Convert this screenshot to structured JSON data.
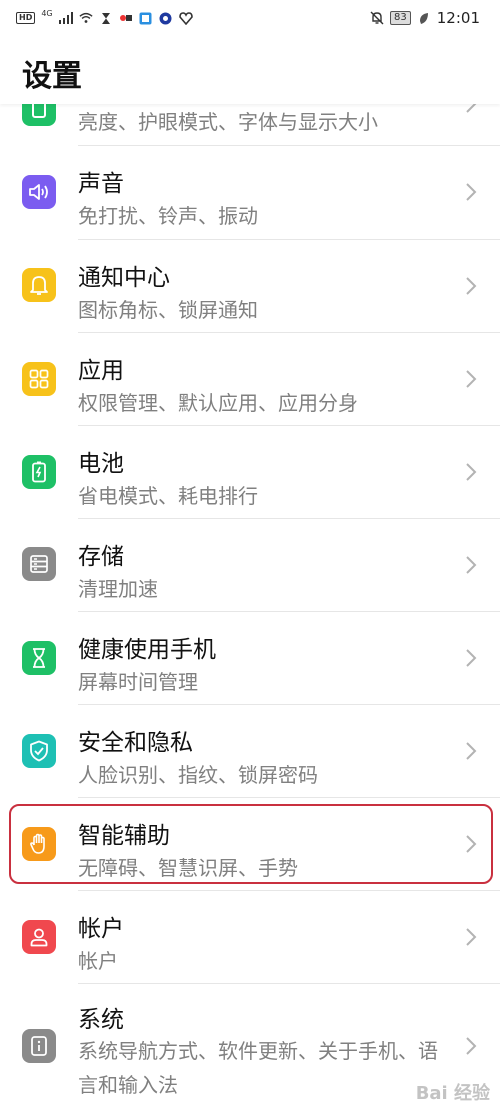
{
  "status_bar": {
    "hd": "HD",
    "network": "4G",
    "battery": "83",
    "time": "12:01"
  },
  "header": {
    "title": "设置"
  },
  "items": [
    {
      "title": "",
      "subtitle": "亮度、护眼模式、字体与显示大小",
      "icon": "display-icon",
      "color": "#1ec066"
    },
    {
      "title": "声音",
      "subtitle": "免打扰、铃声、振动",
      "icon": "speaker-icon",
      "color": "#7b5cf0"
    },
    {
      "title": "通知中心",
      "subtitle": "图标角标、锁屏通知",
      "icon": "bell-icon",
      "color": "#f7c21a"
    },
    {
      "title": "应用",
      "subtitle": "权限管理、默认应用、应用分身",
      "icon": "apps-grid-icon",
      "color": "#f7c21a"
    },
    {
      "title": "电池",
      "subtitle": "省电模式、耗电排行",
      "icon": "battery-icon",
      "color": "#1ec066"
    },
    {
      "title": "存储",
      "subtitle": "清理加速",
      "icon": "storage-icon",
      "color": "#8a8a8a"
    },
    {
      "title": "健康使用手机",
      "subtitle": "屏幕时间管理",
      "icon": "hourglass-icon",
      "color": "#1ec066"
    },
    {
      "title": "安全和隐私",
      "subtitle": "人脸识别、指纹、锁屏密码",
      "icon": "shield-icon",
      "color": "#1ec0b4"
    },
    {
      "title": "智能辅助",
      "subtitle": "无障碍、智慧识屏、手势",
      "icon": "hand-icon",
      "color": "#f79a1a"
    },
    {
      "title": "帐户",
      "subtitle": "帐户",
      "icon": "user-icon",
      "color": "#f0484e"
    },
    {
      "title": "系统",
      "subtitle": "系统导航方式、软件更新、关于手机、语言和输入法",
      "icon": "info-icon",
      "color": "#8a8a8a"
    }
  ],
  "watermark": "Bai 经验"
}
